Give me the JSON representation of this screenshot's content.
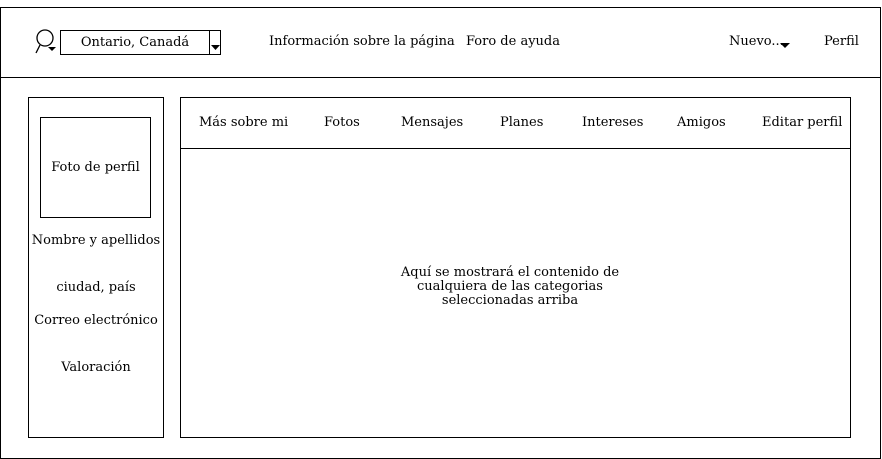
{
  "header": {
    "location_value": "Ontario, Canadá",
    "nav_info": "Información sobre la página",
    "nav_foro": "Foro de ayuda",
    "nav_nuevo": "Nuevo...",
    "nav_perfil": "Perfil"
  },
  "sidebar": {
    "photo_label": "Foto de perfil",
    "name_label": "Nombre y apellidos",
    "city_label": "ciudad, país",
    "email_label": "Correo electrónico",
    "rating_label": "Valoración"
  },
  "main": {
    "tabs": [
      {
        "label": "Más sobre mi"
      },
      {
        "label": "Fotos"
      },
      {
        "label": "Mensajes"
      },
      {
        "label": "Planes"
      },
      {
        "label": "Intereses"
      },
      {
        "label": "Amigos"
      },
      {
        "label": "Editar perfil"
      }
    ],
    "content_text": "Aquí se mostrará el contenido de cualquiera de las categorias seleccionadas arriba"
  },
  "icons": {
    "search": "search-icon",
    "dropdown": "chevron-down-icon"
  }
}
